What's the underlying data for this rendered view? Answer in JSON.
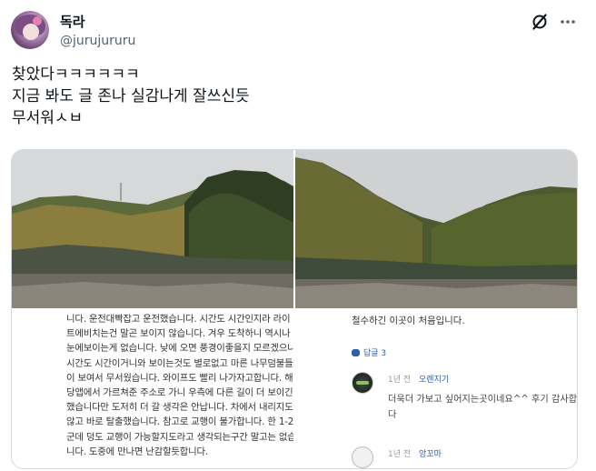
{
  "user": {
    "name": "독라",
    "handle": "@jurujururu"
  },
  "icons": {
    "grok": "grok-icon",
    "more": "more-icon"
  },
  "tweet": {
    "lines": [
      "찾았다ㅋㅋㅋㅋㅋㅋ",
      "지금 봐도 글 존나 실감나게 잘쓰신듯",
      "무서워ㅅㅂ"
    ]
  },
  "media": {
    "left": {
      "text_lines": [
        "니다. 운전대빡잡고 운전했습니다. 시간도 시간인지라 라이",
        "트에비치는건 말곤 보이지 않습니다. 겨우 도착하니 역시나",
        "눈에보이는게 없습니다. 낮에 오면 풍경이좋을지 모르겠으나",
        "시간도 시간이거니와 보이는것도 별로없고 마른 나무덤불들",
        "이 보여서 무서웠습니다. 와이프도 빨리 나가자고합니다. 해",
        "당앱에서 가르쳐준 주소로 가니 우측에 다른 길이 더 보이긴",
        "했습니다만 도저히 더 갈 생각은 안납니다. 차에서 내리지도",
        "않고 바로 탈출했습니다. 참고로 교행이 불가합니다. 한 1-2",
        "군데 덩도 교행이 가능할지도라고 생각되는구간 말고는 없습",
        "니다. 도중에 만나면 난감할듯합니다."
      ]
    },
    "right": {
      "top_text": "철수하긴 이곳이 처음입니다.",
      "reply_count": "답글 3",
      "comments": [
        {
          "time": "1년 전",
          "author": "오렌지기",
          "text_lines": [
            "더욱더 가보고 싶어지는곳이네요^^ 후기 감사합니",
            "다"
          ]
        },
        {
          "time": "1년 전",
          "author": "앙꼬마",
          "text_lines": []
        }
      ]
    }
  }
}
